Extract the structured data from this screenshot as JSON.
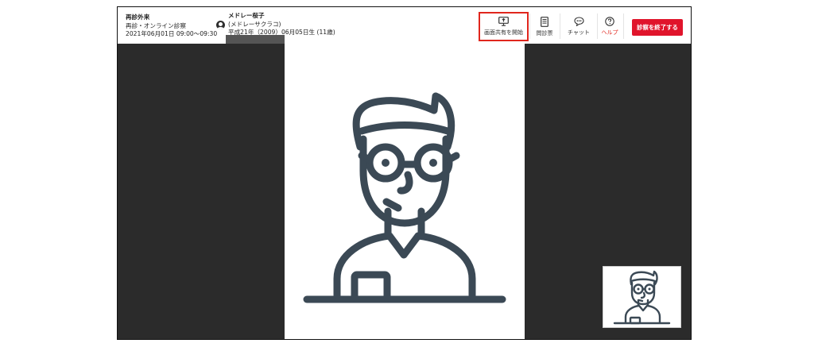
{
  "visit": {
    "department": "再診外来",
    "type": "再診・オンライン診察",
    "datetime": "2021年06月01日 09:00〜09:30"
  },
  "patient": {
    "name": "メドレー桜子",
    "kana": "(メドレーサクラコ)",
    "birth": "平成21年（2009）06月05日生 (11歳)"
  },
  "toolbar": {
    "share_label": "画面共有を開始",
    "inquiry_label": "問診票",
    "chat_label": "チャット",
    "help_label": "ヘルプ",
    "end_label": "診察を終了する"
  },
  "colors": {
    "accent_red": "#e0142b",
    "highlight_border": "#e0261d",
    "video_bg": "#2b2b2b",
    "illustration": "#3b4955"
  },
  "icons": {
    "share": "screen-share-icon",
    "inquiry": "document-icon",
    "chat": "chat-bubble-icon",
    "help": "question-circle-icon",
    "avatar": "person-avatar-icon"
  }
}
